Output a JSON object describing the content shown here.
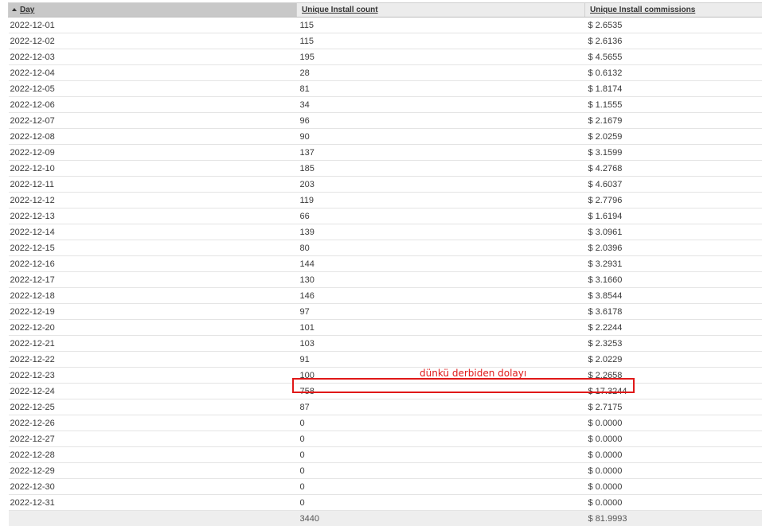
{
  "columns": {
    "day": "Day",
    "count": "Unique Install count",
    "commissions": "Unique Install commissions"
  },
  "rows": [
    {
      "day": "2022-12-01",
      "count": "115",
      "commission": "$ 2.6535"
    },
    {
      "day": "2022-12-02",
      "count": "115",
      "commission": "$ 2.6136"
    },
    {
      "day": "2022-12-03",
      "count": "195",
      "commission": "$ 4.5655"
    },
    {
      "day": "2022-12-04",
      "count": "28",
      "commission": "$ 0.6132"
    },
    {
      "day": "2022-12-05",
      "count": "81",
      "commission": "$ 1.8174"
    },
    {
      "day": "2022-12-06",
      "count": "34",
      "commission": "$ 1.1555"
    },
    {
      "day": "2022-12-07",
      "count": "96",
      "commission": "$ 2.1679"
    },
    {
      "day": "2022-12-08",
      "count": "90",
      "commission": "$ 2.0259"
    },
    {
      "day": "2022-12-09",
      "count": "137",
      "commission": "$ 3.1599"
    },
    {
      "day": "2022-12-10",
      "count": "185",
      "commission": "$ 4.2768"
    },
    {
      "day": "2022-12-11",
      "count": "203",
      "commission": "$ 4.6037"
    },
    {
      "day": "2022-12-12",
      "count": "119",
      "commission": "$ 2.7796"
    },
    {
      "day": "2022-12-13",
      "count": "66",
      "commission": "$ 1.6194"
    },
    {
      "day": "2022-12-14",
      "count": "139",
      "commission": "$ 3.0961"
    },
    {
      "day": "2022-12-15",
      "count": "80",
      "commission": "$ 2.0396"
    },
    {
      "day": "2022-12-16",
      "count": "144",
      "commission": "$ 3.2931"
    },
    {
      "day": "2022-12-17",
      "count": "130",
      "commission": "$ 3.1660"
    },
    {
      "day": "2022-12-18",
      "count": "146",
      "commission": "$ 3.8544"
    },
    {
      "day": "2022-12-19",
      "count": "97",
      "commission": "$ 3.6178"
    },
    {
      "day": "2022-12-20",
      "count": "101",
      "commission": "$ 2.2244"
    },
    {
      "day": "2022-12-21",
      "count": "103",
      "commission": "$ 2.3253"
    },
    {
      "day": "2022-12-22",
      "count": "91",
      "commission": "$ 2.0229"
    },
    {
      "day": "2022-12-23",
      "count": "100",
      "commission": "$ 2.2658"
    },
    {
      "day": "2022-12-24",
      "count": "758",
      "commission": "$ 17.3244"
    },
    {
      "day": "2022-12-25",
      "count": "87",
      "commission": "$ 2.7175"
    },
    {
      "day": "2022-12-26",
      "count": "0",
      "commission": "$ 0.0000"
    },
    {
      "day": "2022-12-27",
      "count": "0",
      "commission": "$ 0.0000"
    },
    {
      "day": "2022-12-28",
      "count": "0",
      "commission": "$ 0.0000"
    },
    {
      "day": "2022-12-29",
      "count": "0",
      "commission": "$ 0.0000"
    },
    {
      "day": "2022-12-30",
      "count": "0",
      "commission": "$ 0.0000"
    },
    {
      "day": "2022-12-31",
      "count": "0",
      "commission": "$ 0.0000"
    }
  ],
  "totals": {
    "count": "3440",
    "commission": "$ 81.9993"
  },
  "annotation": {
    "text": "dünkü derbiden dolayı",
    "color": "#e01818"
  },
  "sort": {
    "column": "day",
    "direction": "ascending",
    "icon": "sort-ascending-icon"
  }
}
